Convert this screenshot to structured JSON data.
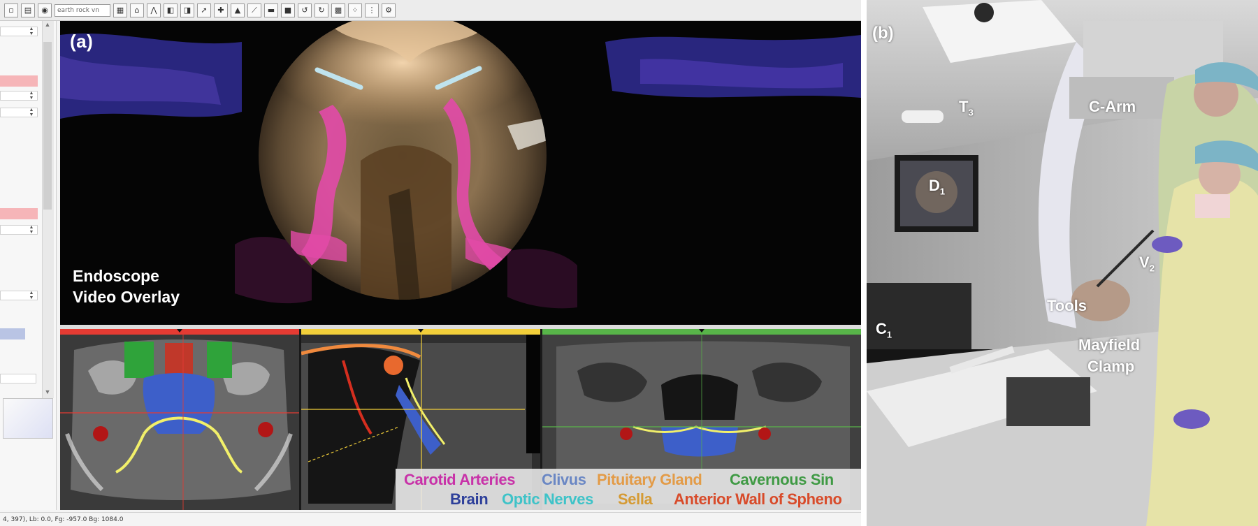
{
  "toolbar": {
    "input_value": "earth rock vn",
    "buttons": [
      "new-icon",
      "save-icon",
      "view-icon",
      "map-icon",
      "contour-icon",
      "arrow-icon",
      "tool-icon",
      "cube-icon",
      "mesh-icon",
      "measure-icon",
      "camera-icon",
      "grid-icon",
      "undo-icon",
      "redo-icon",
      "screenshot-icon",
      "points-icon",
      "nodes-icon",
      "settings-icon"
    ]
  },
  "panel_a": {
    "label": "(a)",
    "caption_line1": "Endoscope",
    "caption_line2": "Video Overlay",
    "view_colors": [
      "#e53b33",
      "#f2cf3a",
      "#58b549"
    ]
  },
  "legend": {
    "row1": [
      {
        "text": "Carotid Arteries",
        "color": "#c832a8"
      },
      {
        "text": "Clivus",
        "color": "#6a87c4"
      },
      {
        "text": "Pituitary Gland",
        "color": "#e39b47"
      },
      {
        "text": "Cavernous Sin",
        "color": "#3f9a44"
      }
    ],
    "row2": [
      {
        "text": "Brain",
        "color": "#2d3f9a"
      },
      {
        "text": "Optic Nerves",
        "color": "#3ec3c8"
      },
      {
        "text": "Sella",
        "color": "#d59a33"
      },
      {
        "text": "Anterior Wall of Spheno",
        "color": "#d84b2a"
      }
    ]
  },
  "statusbar": {
    "text": "4, 397), Lb: 0.0, Fg: -957.0 Bg: 1084.0"
  },
  "panel_b": {
    "label": "(b)",
    "labels": {
      "t3": "T",
      "t3_sub": "3",
      "carm": "C-Arm",
      "d1": "D",
      "d1_sub": "1",
      "v2": "V",
      "v2_sub": "2",
      "tools": "Tools",
      "c1": "C",
      "c1_sub": "1",
      "mayfield1": "Mayfield",
      "mayfield2": "Clamp"
    }
  }
}
